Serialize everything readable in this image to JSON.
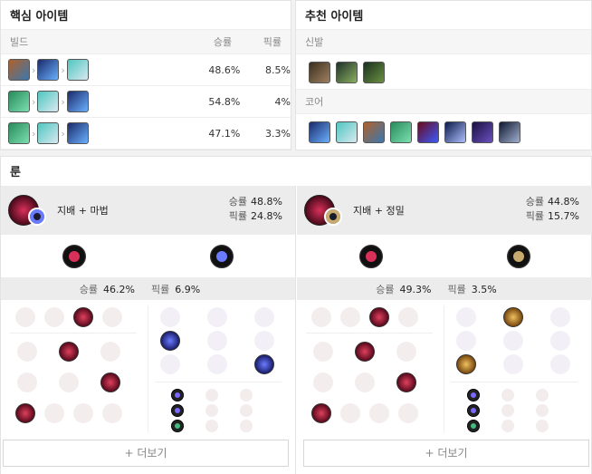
{
  "core_items": {
    "title": "핵심 아이템",
    "col_build": "빌드",
    "col_winrate": "승률",
    "col_pickrate": "픽률",
    "rows": [
      {
        "items": [
          "orange-tome-icon",
          "blue-staff-icon",
          "champion-face-icon"
        ],
        "winrate": "48.6%",
        "pickrate": "8.5%"
      },
      {
        "items": [
          "green-tome-icon",
          "champion-face-icon",
          "blue-staff-icon"
        ],
        "winrate": "54.8%",
        "pickrate": "4%"
      },
      {
        "items": [
          "green-tome-icon",
          "champion-face-icon",
          "blue-staff-icon"
        ],
        "winrate": "47.1%",
        "pickrate": "3.3%"
      }
    ]
  },
  "recommended_items": {
    "title": "추천 아이템",
    "boots_label": "신발",
    "core_label": "코어",
    "boots": [
      "sorcerer-boots-icon",
      "mercury-boots-icon",
      "swift-boots-icon"
    ],
    "core": [
      "blue-staff-icon",
      "champion-face-icon",
      "orange-tome-icon",
      "green-tome-icon",
      "red-hourglass-icon",
      "blue-orb-icon",
      "purple-blade-icon",
      "silver-wand-icon"
    ]
  },
  "runes": {
    "title": "룬",
    "pages": [
      {
        "label": "지배 + 마법",
        "winrate_label": "승률",
        "winrate": "48.8%",
        "pickrate_label": "픽률",
        "pickrate": "24.8%",
        "stat_winrate_label": "승률",
        "stat_winrate": "46.2%",
        "stat_pickrate_label": "픽률",
        "stat_pickrate": "6.9%",
        "more": "+ 더보기"
      },
      {
        "label": "지배 + 정밀",
        "winrate_label": "승률",
        "winrate": "44.8%",
        "pickrate_label": "픽률",
        "pickrate": "15.7%",
        "stat_winrate_label": "승률",
        "stat_winrate": "49.3%",
        "stat_pickrate_label": "픽률",
        "stat_pickrate": "3.5%",
        "more": "+ 더보기"
      }
    ]
  },
  "colors": {
    "domination": "#d9305a",
    "sorcery": "#6a7bff",
    "precision": "#c8aa6e"
  }
}
